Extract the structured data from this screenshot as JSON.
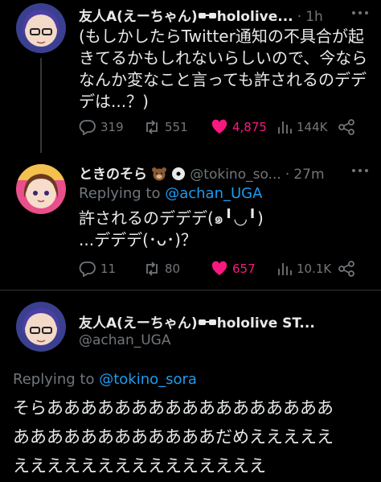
{
  "tweets": [
    {
      "name": "友人A(えーちゃん)",
      "name_suffix": "hololive...",
      "dot": "·",
      "time": "1h",
      "text_lines": [
        "(もしかしたらTwitter通知の不具合が起",
        "きてるかもしれないらしいので、今なら",
        "なんか変なこと言っても許されるのデデ",
        "デは...？)"
      ],
      "replies": "319",
      "retweets": "551",
      "likes": "4,875",
      "views": "144K"
    },
    {
      "name": "ときのそら",
      "handle": "@tokino_so...",
      "dot": "·",
      "time": "27m",
      "replying_prefix": "Replying to ",
      "replying_to": "@achan_UGA",
      "text_lines": [
        "許されるのデデデ(๑╹◡╹)",
        "...デデデ(･ᴗ･)？"
      ],
      "replies": "11",
      "retweets": "80",
      "likes": "657",
      "views": "10.1K"
    },
    {
      "name": "友人A(えーちゃん)",
      "name_suffix": "hololive ST...",
      "handle": "@achan_UGA",
      "replying_prefix": "Replying to ",
      "replying_to": "@tokino_sora",
      "text_lines": [
        "そらあああああああああああああああああ",
        "ああああああああああああだめえええええ",
        "えええええええええええええええ"
      ]
    }
  ],
  "colors": {
    "background": "#000000",
    "text": "#e7e9ea",
    "muted": "#71767b",
    "link": "#1d9bf0",
    "like": "#f91880"
  },
  "icons": [
    "sunglasses-emoji",
    "bear-emoji",
    "disc-emoji",
    "reply-icon",
    "retweet-icon",
    "heart-icon",
    "views-icon",
    "share-icon"
  ]
}
